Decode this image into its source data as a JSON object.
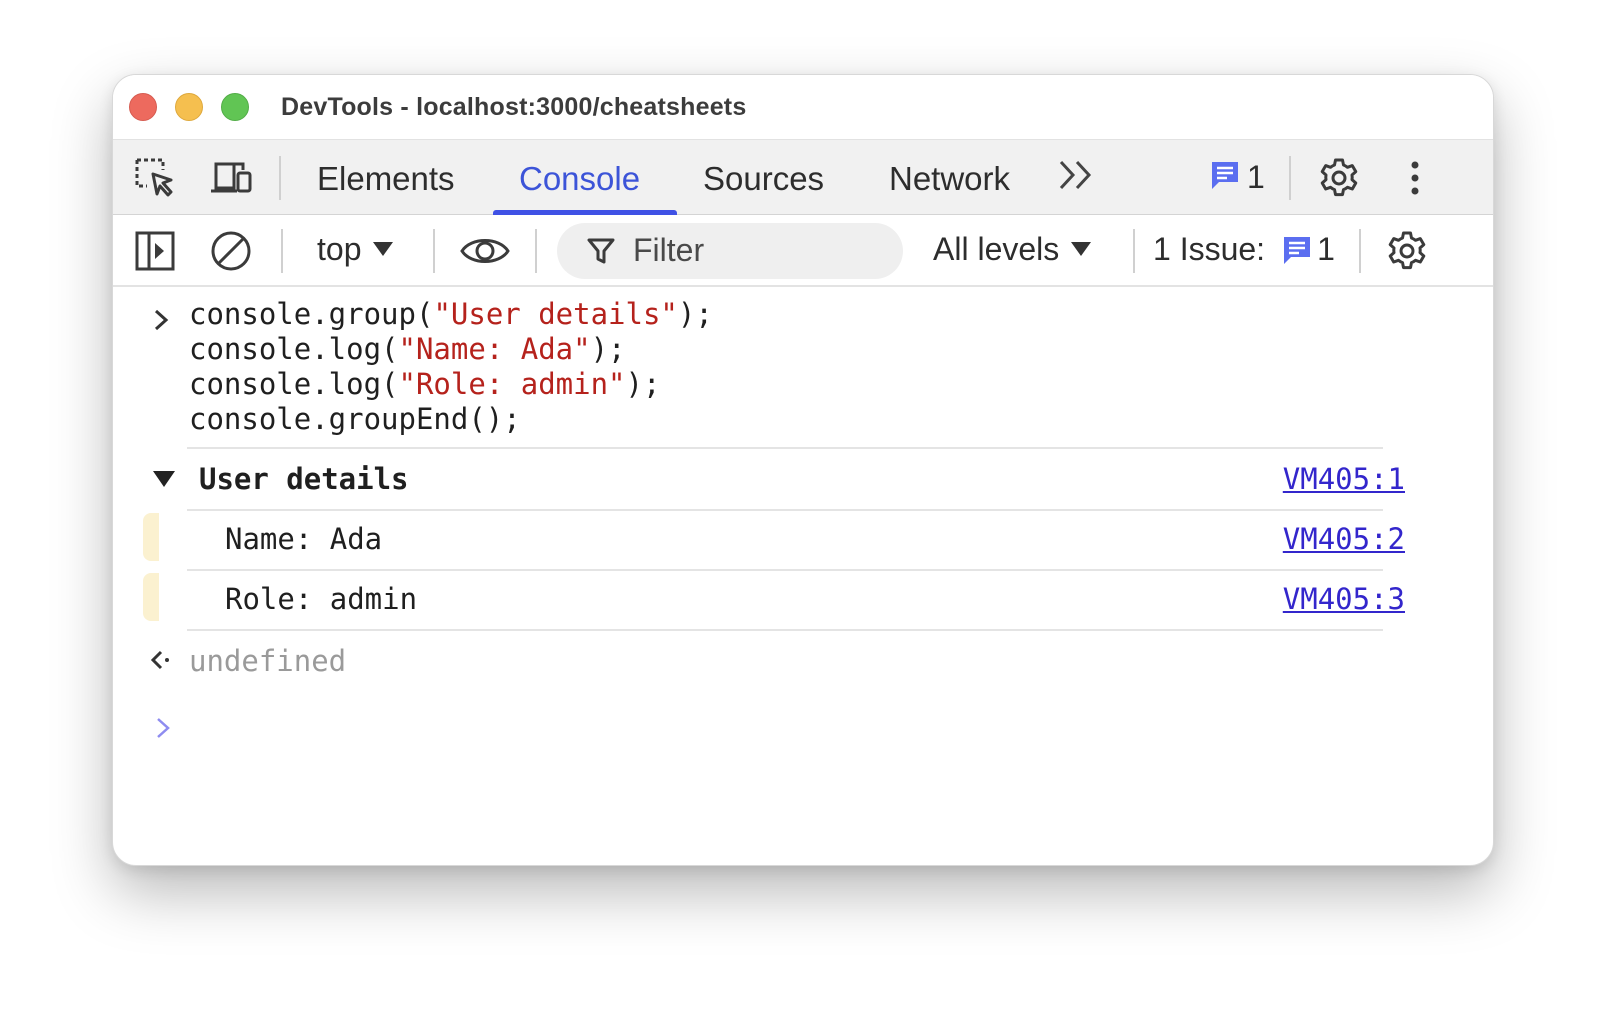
{
  "window": {
    "title": "DevTools - localhost:3000/cheatsheets"
  },
  "tabs": [
    {
      "label": "Elements",
      "active": false
    },
    {
      "label": "Console",
      "active": true
    },
    {
      "label": "Sources",
      "active": false
    },
    {
      "label": "Network",
      "active": false
    }
  ],
  "tabbar": {
    "more_label": "»",
    "issues_badge_count": "1"
  },
  "toolbar": {
    "context": "top",
    "filter_placeholder": "Filter",
    "levels": "All levels",
    "issues_label": "1 Issue:",
    "issues_count": "1"
  },
  "console": {
    "input_lines": [
      {
        "prefix": "console.group(",
        "string": "\"User details\"",
        "suffix": ");"
      },
      {
        "prefix": "console.log(",
        "string": "\"Name: Ada\"",
        "suffix": ");"
      },
      {
        "prefix": "console.log(",
        "string": "\"Role: admin\"",
        "suffix": ");"
      },
      {
        "prefix": "console.groupEnd();",
        "string": "",
        "suffix": ""
      }
    ],
    "group": {
      "title": "User details",
      "source": "VM405:1",
      "expanded": true
    },
    "messages": [
      {
        "text": "Name: Ada",
        "source": "VM405:2"
      },
      {
        "text": "Role: admin",
        "source": "VM405:3"
      }
    ],
    "return_value": "undefined"
  },
  "colors": {
    "accent": "#3f51e5",
    "string": "#b5221c",
    "link": "#3326cc",
    "issue_icon": "#5b6ef0"
  },
  "icons": {
    "inspect": "inspect-element-icon",
    "device": "device-toolbar-icon",
    "settings": "gear-icon",
    "menu": "kebab-menu-icon",
    "sidebar": "sidebar-toggle-icon",
    "clear": "clear-console-icon",
    "eye": "live-expression-eye-icon",
    "filter": "filter-funnel-icon",
    "issue": "message-square-icon"
  }
}
